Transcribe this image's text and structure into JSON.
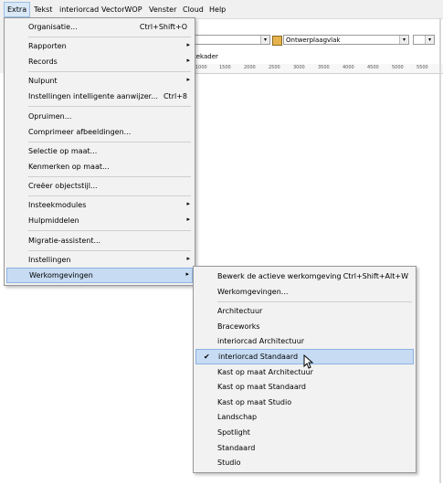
{
  "menubar": {
    "items": [
      "Extra",
      "Tekst",
      "interiorcad",
      "VectorWOP",
      "Venster",
      "Cloud",
      "Help"
    ]
  },
  "toolbar": {
    "combo_text": "Ontwerplaagvlak",
    "tab_label": "tekader"
  },
  "ruler": {
    "labels": [
      "1000",
      "1500",
      "2000",
      "2500",
      "3000",
      "3500",
      "4000",
      "4500",
      "5000",
      "5500"
    ]
  },
  "extra_menu": {
    "items": [
      {
        "label": "Organisatie...",
        "shortcut": "Ctrl+Shift+O"
      },
      {
        "label": "Rapporten",
        "submenu": true
      },
      {
        "label": "Records",
        "submenu": true
      },
      {
        "label": "Nulpunt",
        "submenu": true
      },
      {
        "label": "Instellingen intelligente aanwijzer...",
        "shortcut": "Ctrl+8"
      },
      {
        "label": "Opruimen..."
      },
      {
        "label": "Comprimeer afbeeldingen..."
      },
      {
        "label": "Selectie op maat..."
      },
      {
        "label": "Kenmerken op maat..."
      },
      {
        "label": "Creëer objectstijl..."
      },
      {
        "label": "Insteekmodules",
        "submenu": true
      },
      {
        "label": "Hulpmiddelen",
        "submenu": true
      },
      {
        "label": "Migratie-assistent..."
      },
      {
        "label": "Instellingen",
        "submenu": true
      },
      {
        "label": "Werkomgevingen",
        "submenu": true
      }
    ]
  },
  "werkomgevingen_menu": {
    "items": [
      {
        "label": "Bewerk de actieve werkomgeving",
        "shortcut": "Ctrl+Shift+Alt+W"
      },
      {
        "label": "Werkomgevingen..."
      },
      {
        "label": "Architectuur"
      },
      {
        "label": "Braceworks"
      },
      {
        "label": "interiorcad Architectuur"
      },
      {
        "label": "interiorcad Standaard",
        "checked": true
      },
      {
        "label": "Kast op maat Architectuur"
      },
      {
        "label": "Kast op maat Standaard"
      },
      {
        "label": "Kast op maat Studio"
      },
      {
        "label": "Landschap"
      },
      {
        "label": "Spotlight"
      },
      {
        "label": "Standaard"
      },
      {
        "label": "Studio"
      }
    ],
    "check_glyph": "✔"
  },
  "glyphs": {
    "submenu_arrow": "▸",
    "dropdown_arrow": "▾"
  }
}
